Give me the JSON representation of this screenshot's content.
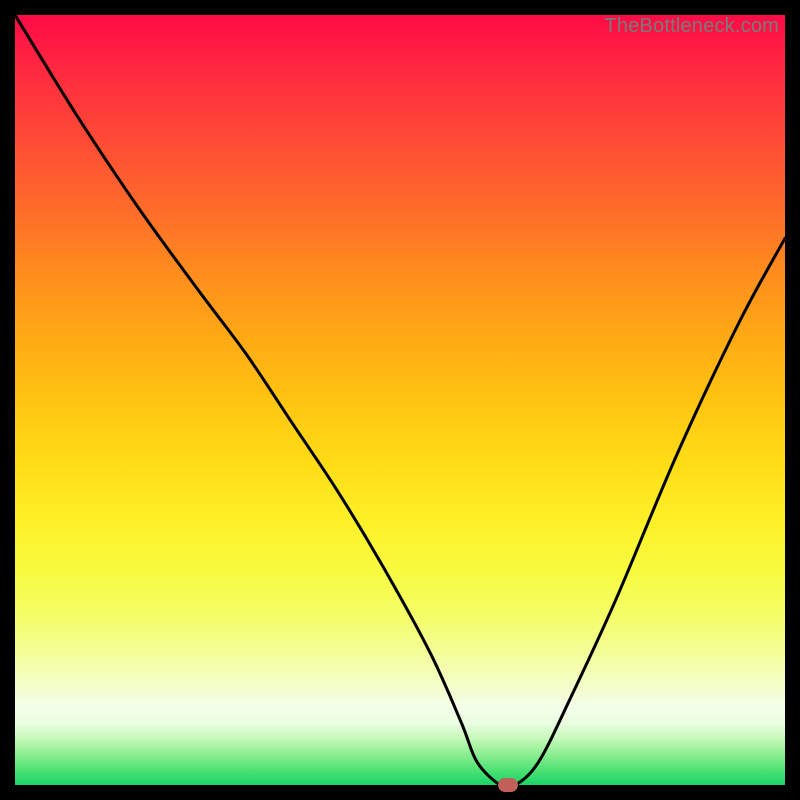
{
  "watermark": "TheBottleneck.com",
  "chart_data": {
    "type": "line",
    "title": "",
    "xlabel": "",
    "ylabel": "",
    "xlim": [
      0,
      100
    ],
    "ylim": [
      0,
      100
    ],
    "grid": false,
    "legend": false,
    "series": [
      {
        "name": "bottleneck-curve",
        "x": [
          0,
          8,
          16,
          24,
          30,
          36,
          42,
          48,
          54,
          58,
          60,
          63,
          65,
          68,
          72,
          78,
          86,
          94,
          100
        ],
        "values": [
          100,
          87,
          75,
          64,
          56,
          47,
          38,
          28,
          17,
          8,
          3,
          0,
          0,
          3,
          11,
          24,
          43,
          60,
          71
        ]
      }
    ],
    "marker": {
      "x": 64,
      "y": 0,
      "color": "#c06058"
    },
    "gradient_stops": [
      {
        "pos": 0,
        "color": "#ff0b46"
      },
      {
        "pos": 50,
        "color": "#ffc411"
      },
      {
        "pos": 90,
        "color": "#f3feea"
      },
      {
        "pos": 100,
        "color": "#1bd465"
      }
    ]
  }
}
